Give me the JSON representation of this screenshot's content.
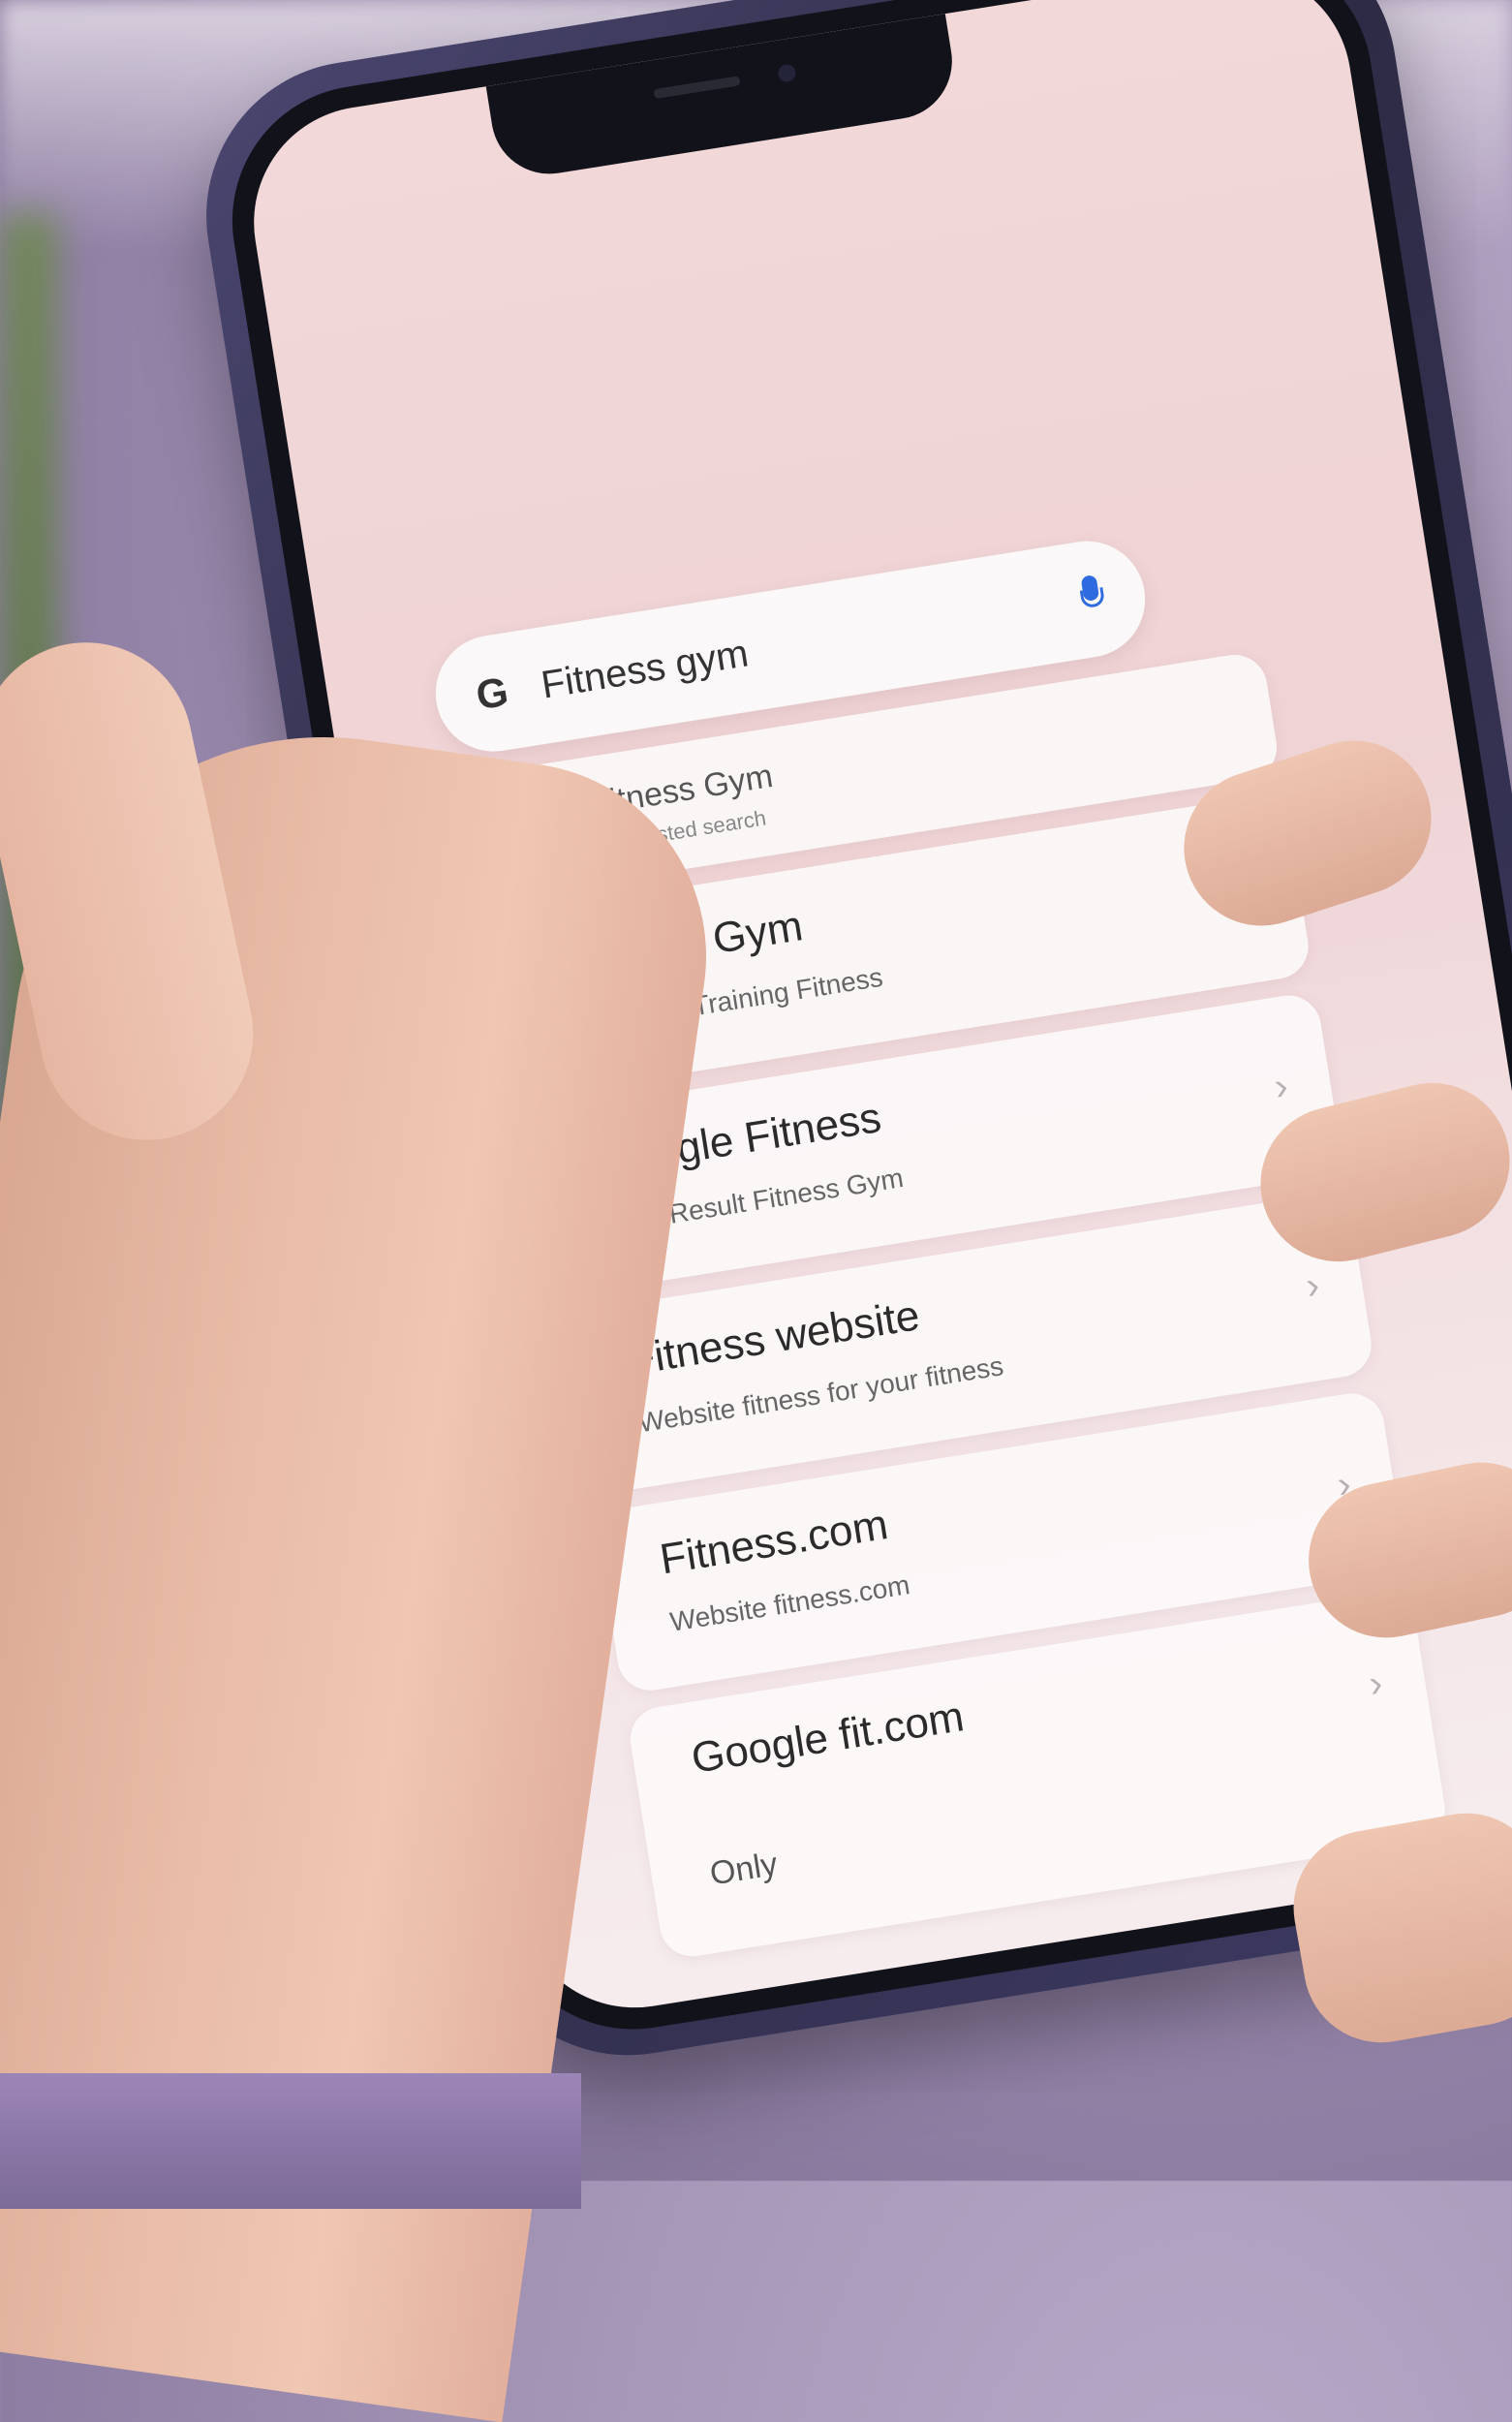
{
  "search": {
    "logo": "G",
    "query": "Fitness gym"
  },
  "suggestions": [
    {
      "title": "Fitness Gym",
      "subtitle": "Suggested search",
      "kind": "query"
    },
    {
      "title": "Fitness Gym",
      "subtitle": "Places of Training Fitness"
    },
    {
      "title": "Google Fitness",
      "subtitle": "Web Result Fitness Gym"
    },
    {
      "title": "Fitness website",
      "subtitle": "Website fitness for your fitness"
    },
    {
      "title": "Fitness.com",
      "subtitle": "Website fitness.com"
    },
    {
      "title": "Google fit.com",
      "subtitle": "Only"
    }
  ],
  "colors": {
    "accent": "#2f6be0",
    "screen_bg": "#f2d8d8",
    "frame": "#3e3a64"
  },
  "icons": {
    "search": "search-icon",
    "mic": "mic-icon",
    "chevron": "chevron-right-icon"
  }
}
